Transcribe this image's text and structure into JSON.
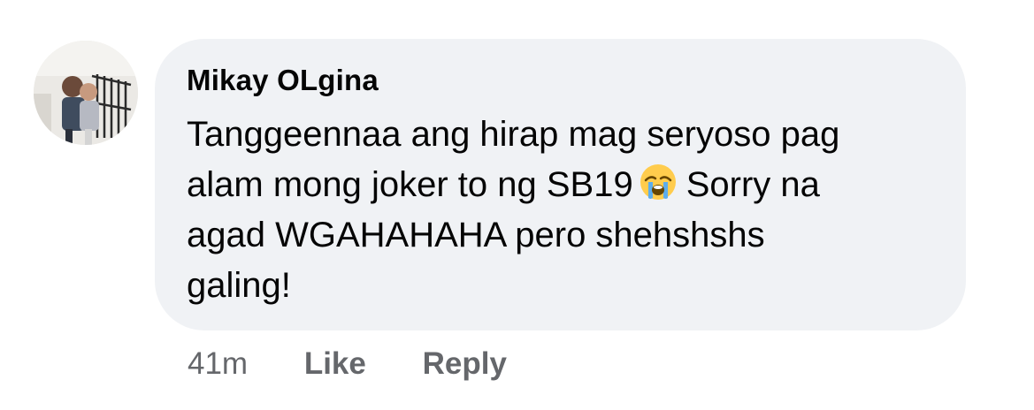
{
  "comment": {
    "author": "Mikay OLgina",
    "text_lines": [
      "Tanggeennaa ang hirap mag seryoso pag",
      "alam mong joker to ng SB19",
      "Sorry na",
      "agad WGAHAHAHA pero shehshshs",
      "galing!"
    ],
    "emoji": "loudly-crying-face-icon"
  },
  "actions": {
    "timestamp": "41m",
    "like_label": "Like",
    "reply_label": "Reply"
  },
  "colors": {
    "bubble": "#f0f2f5",
    "text": "#050505",
    "meta": "#65676b"
  }
}
